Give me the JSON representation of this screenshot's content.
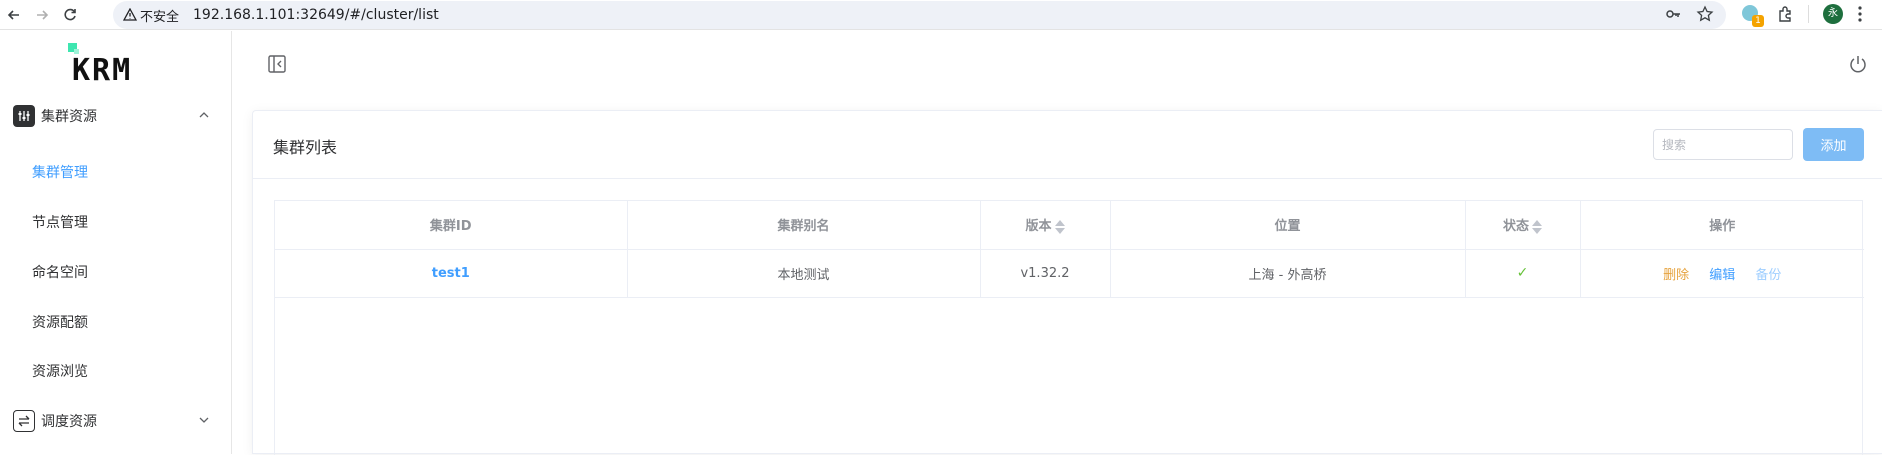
{
  "browser": {
    "security_label": "不安全",
    "url": "192.168.1.101:32649/#/cluster/list",
    "extension_badge": "1",
    "profile_initial": "永",
    "icons": [
      "back-icon",
      "forward-icon",
      "reload-icon",
      "key-icon",
      "star-icon",
      "extensions-icon",
      "menu-icon"
    ]
  },
  "sidebar": {
    "logo_text": "KRM",
    "groups": [
      {
        "label": "集群资源",
        "icon": "sliders-icon",
        "expanded": true
      },
      {
        "label": "调度资源",
        "icon": "switch-icon",
        "expanded": false
      }
    ],
    "items": [
      {
        "label": "集群管理",
        "active": true
      },
      {
        "label": "节点管理",
        "active": false
      },
      {
        "label": "命名空间",
        "active": false
      },
      {
        "label": "资源配额",
        "active": false
      },
      {
        "label": "资源浏览",
        "active": false
      }
    ]
  },
  "card": {
    "title": "集群列表",
    "search_placeholder": "搜索",
    "add_label": "添加"
  },
  "table": {
    "columns": [
      "集群ID",
      "集群别名",
      "版本",
      "位置",
      "状态",
      "操作"
    ],
    "rows": [
      {
        "id": "test1",
        "alias": "本地测试",
        "version": "v1.32.2",
        "location": "上海 - 外高桥",
        "status": "✓"
      }
    ],
    "actions": [
      "删除",
      "编辑",
      "备份"
    ]
  },
  "colors": {
    "primary": "#409eff",
    "warning": "#e6a23c",
    "success": "#67c23a",
    "logo_accent": "#3ee6b0"
  }
}
